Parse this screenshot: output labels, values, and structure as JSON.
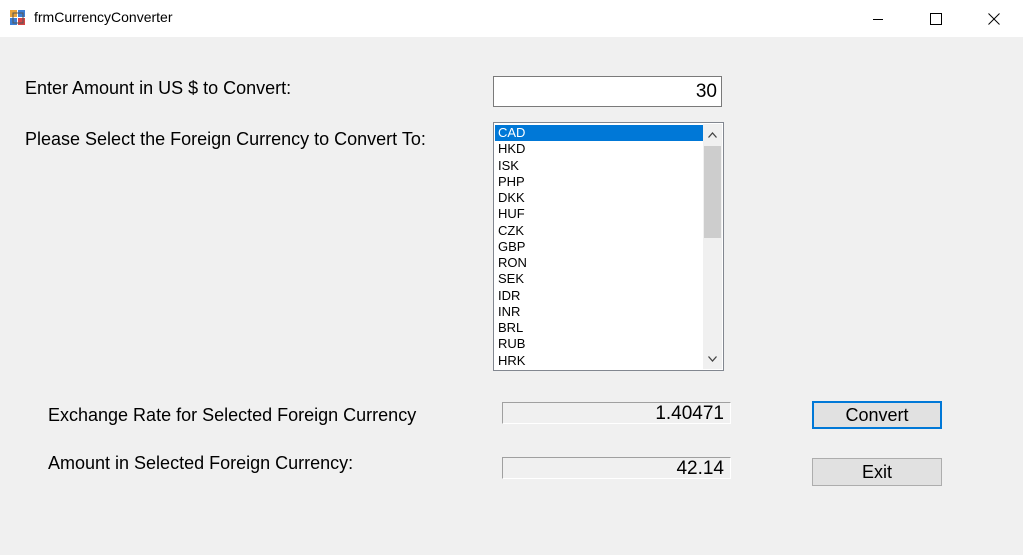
{
  "window": {
    "title": "frmCurrencyConverter",
    "icon": "form-icon",
    "controls": {
      "minimize": "minimize-icon",
      "maximize": "maximize-icon",
      "close": "close-icon"
    }
  },
  "form": {
    "amount_label": "Enter Amount in US $ to Convert:",
    "amount_value": "30",
    "currency_label": "Please Select the Foreign Currency to Convert To:",
    "currency_list": {
      "selected": "CAD",
      "items": [
        "CAD",
        "HKD",
        "ISK",
        "PHP",
        "DKK",
        "HUF",
        "CZK",
        "GBP",
        "RON",
        "SEK",
        "IDR",
        "INR",
        "BRL",
        "RUB",
        "HRK"
      ]
    },
    "rate_label": "Exchange Rate for Selected Foreign Currency",
    "rate_value": "1.40471",
    "converted_label": "Amount in Selected Foreign Currency:",
    "converted_value": "42.14",
    "convert_button": "Convert",
    "exit_button": "Exit"
  },
  "colors": {
    "selection": "#0078d7",
    "background": "#f0f0f0",
    "default_button_border": "#0078d7"
  }
}
